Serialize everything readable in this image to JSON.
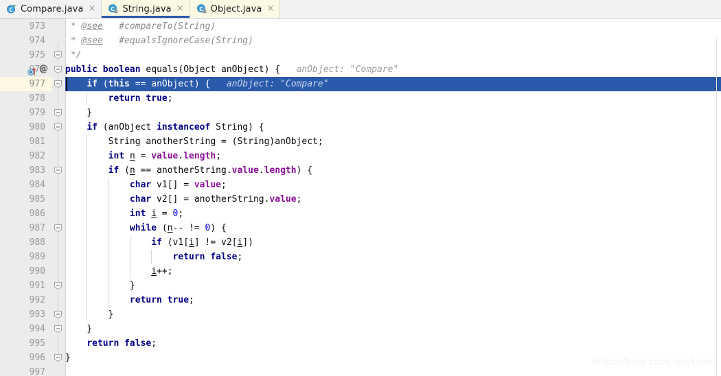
{
  "tabs": [
    {
      "label": "Compare.java",
      "icon": "java-runnable-class-icon",
      "state": "inactive",
      "close": "×"
    },
    {
      "label": "String.java",
      "icon": "java-readonly-class-icon",
      "state": "active",
      "close": "×"
    },
    {
      "label": "Object.java",
      "icon": "java-readonly-class-icon",
      "state": "inactive-tinted",
      "close": "×"
    }
  ],
  "editor": {
    "caret_line": 977,
    "selection_color": "#2b5aab",
    "current_line_gutter_color": "#fdf9e4",
    "watermark": "https://blog.csdn.net/klionl",
    "lines": [
      {
        "n": 973,
        "text": " * @see   #compareTo(String)"
      },
      {
        "n": 974,
        "text": " * @see   #equalsIgnoreCase(String)"
      },
      {
        "n": 975,
        "text": " */"
      },
      {
        "n": 976,
        "text": "public boolean equals(Object anObject) {   anObject: \"Compare\""
      },
      {
        "n": 977,
        "text": "    if (this == anObject) {   anObject: \"Compare\""
      },
      {
        "n": 978,
        "text": "        return true;"
      },
      {
        "n": 979,
        "text": "    }"
      },
      {
        "n": 980,
        "text": "    if (anObject instanceof String) {"
      },
      {
        "n": 981,
        "text": "        String anotherString = (String)anObject;"
      },
      {
        "n": 982,
        "text": "        int n = value.length;"
      },
      {
        "n": 983,
        "text": "        if (n == anotherString.value.length) {"
      },
      {
        "n": 984,
        "text": "            char v1[] = value;"
      },
      {
        "n": 985,
        "text": "            char v2[] = anotherString.value;"
      },
      {
        "n": 986,
        "text": "            int i = 0;"
      },
      {
        "n": 987,
        "text": "            while (n-- != 0) {"
      },
      {
        "n": 988,
        "text": "                if (v1[i] != v2[i])"
      },
      {
        "n": 989,
        "text": "                    return false;"
      },
      {
        "n": 990,
        "text": "                i++;"
      },
      {
        "n": 991,
        "text": "            }"
      },
      {
        "n": 992,
        "text": "            return true;"
      },
      {
        "n": 993,
        "text": "        }"
      },
      {
        "n": 994,
        "text": "    }"
      },
      {
        "n": 995,
        "text": "    return false;"
      },
      {
        "n": 996,
        "text": "}"
      },
      {
        "n": 997,
        "text": ""
      }
    ],
    "inline_hints": [
      {
        "line": 976,
        "text": "anObject: \"Compare\""
      },
      {
        "line": 977,
        "text": "anObject: \"Compare\""
      }
    ],
    "gutter_markers": [
      {
        "line": 976,
        "icon": "method-override-icon"
      },
      {
        "line": 976,
        "icon": "annotation-at-icon",
        "glyph": "@"
      }
    ],
    "fold_markers": [
      975,
      976,
      977,
      979,
      980,
      983,
      987,
      991,
      993,
      994,
      996
    ]
  }
}
